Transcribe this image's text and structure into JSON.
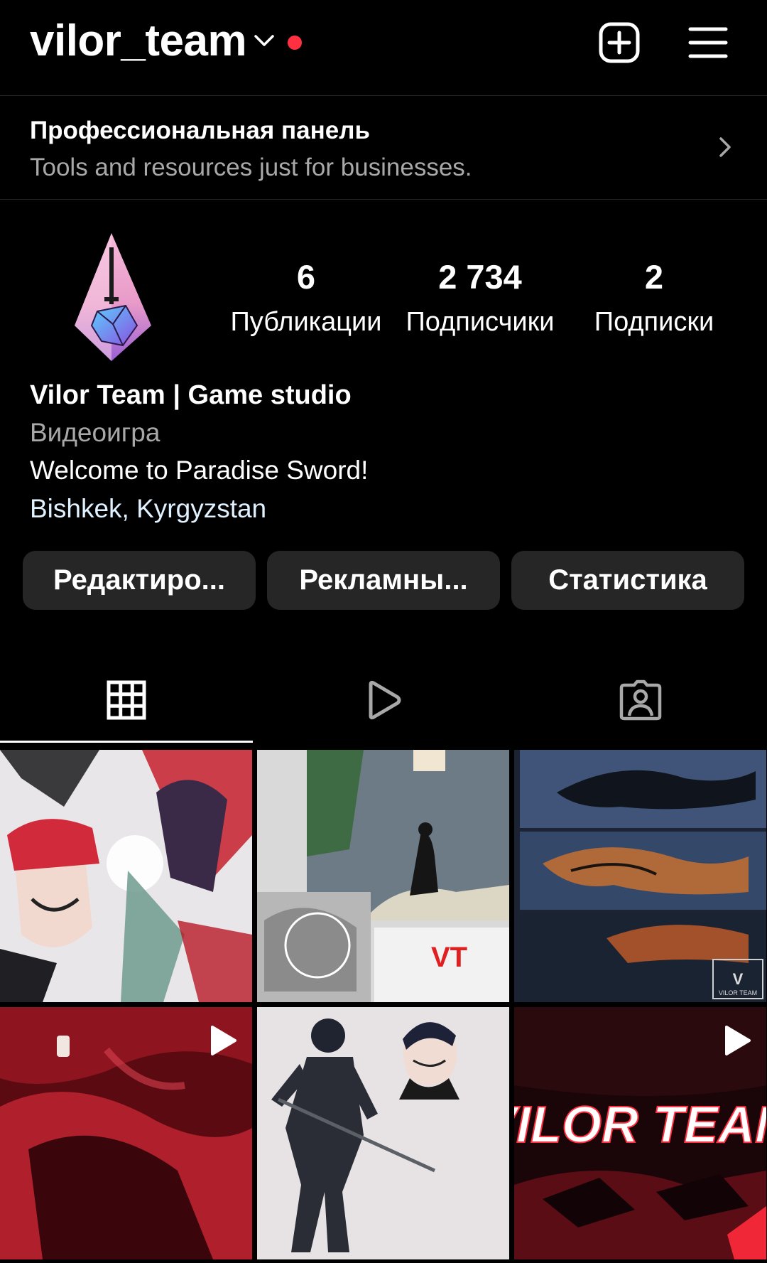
{
  "header": {
    "username": "vilor_team"
  },
  "pro_panel": {
    "title": "Профессиональная панель",
    "subtitle": "Tools and resources just for businesses."
  },
  "stats": [
    {
      "value": "6",
      "label": "Публикации"
    },
    {
      "value": "2 734",
      "label": "Подписчики"
    },
    {
      "value": "2",
      "label": "Подписки"
    }
  ],
  "bio": {
    "name": "Vilor Team | Game studio",
    "category": "Видеоигра",
    "text": "Welcome to Paradise Sword!",
    "location": "Bishkek, Kyrgyzstan"
  },
  "buttons": {
    "edit": "Редактиро...",
    "ads": "Рекламны...",
    "stats": "Статистика"
  },
  "tabs": [
    {
      "icon": "grid-icon",
      "active": true
    },
    {
      "icon": "reels-icon",
      "active": false
    },
    {
      "icon": "tagged-icon",
      "active": false
    }
  ],
  "posts": [
    {
      "type": "image",
      "overlay_text": "",
      "image": "anime character splash art"
    },
    {
      "type": "image",
      "overlay_text": "VT",
      "image": "storyboard collage"
    },
    {
      "type": "image",
      "overlay_text": "VILOR TEAM",
      "image": "snowy landscapes"
    },
    {
      "type": "video",
      "overlay_text": "",
      "image": "red cave scene"
    },
    {
      "type": "image",
      "overlay_text": "",
      "image": "swordsman character sheet"
    },
    {
      "type": "video",
      "overlay_text": "VILOR TEAM",
      "image": "red logo title"
    }
  ],
  "colors": {
    "background": "#000000",
    "notification_dot": "#ff3040",
    "button_bg": "#262626",
    "muted_text": "#a8a8a8",
    "location_link": "#e0f1ff"
  }
}
